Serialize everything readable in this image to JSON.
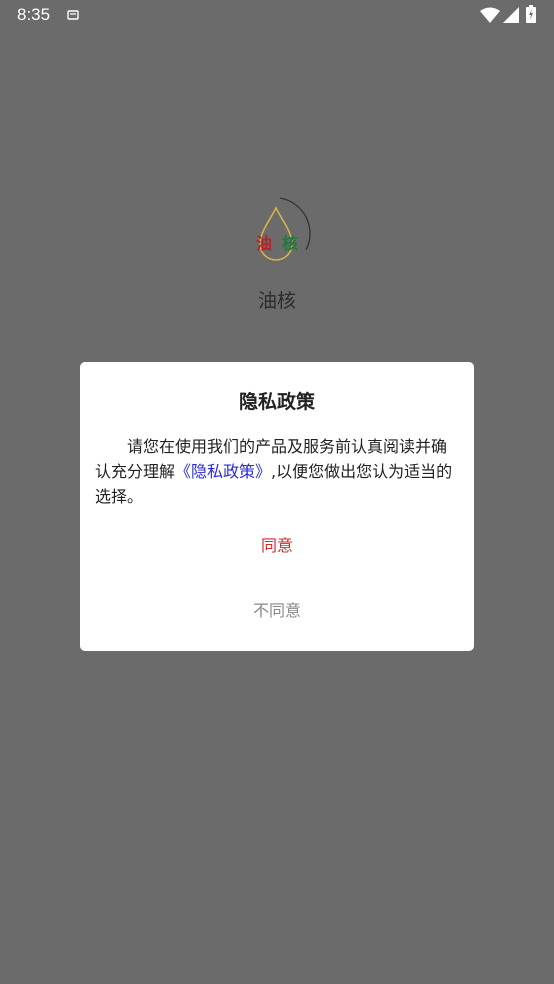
{
  "status_bar": {
    "time": "8:35",
    "icons": [
      "notification-icon",
      "wifi-icon",
      "signal-icon",
      "battery-icon"
    ]
  },
  "splash": {
    "logo_chars": [
      "油",
      "核"
    ],
    "app_name": "油核"
  },
  "dialog": {
    "title": "隐私政策",
    "body_before": "请您在使用我们的产品及服务前认真阅读并确认充分理解",
    "policy_link": "《隐私政策》",
    "body_after": ",以便您做出您认为适当的选择。",
    "agree_label": "同意",
    "disagree_label": "不同意"
  },
  "colors": {
    "overlay": "#6b6b6b",
    "agree": "#d32b2b",
    "disagree": "#888888",
    "link": "#2a2ad6",
    "logo_red": "#b8232b",
    "logo_green": "#1f7a3a",
    "logo_gold": "#d4b24a"
  }
}
